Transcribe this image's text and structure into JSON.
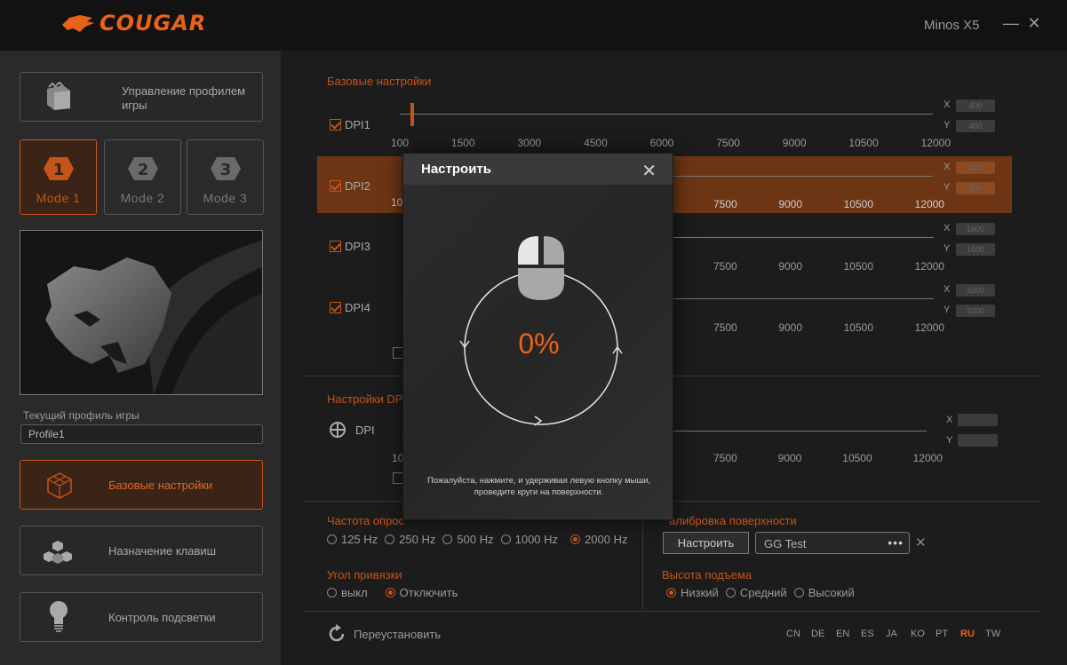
{
  "app": {
    "brand": "COUGAR",
    "device": "Minos X5",
    "minimize": "—",
    "close": "✕"
  },
  "sidebar": {
    "profile_manager": "Управление профилем игры",
    "modes": [
      {
        "label": "Mode 1",
        "number": "1"
      },
      {
        "label": "Mode 2",
        "number": "2"
      },
      {
        "label": "Mode 3",
        "number": "3"
      }
    ],
    "current_profile_caption": "Текущий профиль игры",
    "current_profile_value": "Profile1",
    "nav": [
      {
        "label": "Базовые настройки"
      },
      {
        "label": "Назначение клавиш"
      },
      {
        "label": "Контроль подсветки"
      }
    ]
  },
  "basic": {
    "title": "Базовые настройки",
    "ticks": [
      "100",
      "1500",
      "3000",
      "4500",
      "6000",
      "7500",
      "9000",
      "10500",
      "12000"
    ],
    "ticks_partial": [
      "10",
      "7500",
      "9000",
      "10500",
      "12000"
    ],
    "dpi_rows": [
      {
        "label": "DPI1",
        "x": "400",
        "y": "400"
      },
      {
        "label": "DPI2",
        "x": "800",
        "y": "800"
      },
      {
        "label": "DPI3",
        "x": "1600",
        "y": "1600"
      },
      {
        "label": "DPI4",
        "x": "3200",
        "y": "3200"
      }
    ],
    "x_label": "X",
    "y_label": "Y"
  },
  "dpi_settings": {
    "title": "Настройки DP",
    "label": "DPI",
    "ticks": [
      "10",
      "7500",
      "9000",
      "10500",
      "12000"
    ]
  },
  "polling": {
    "title": "Частота опрос",
    "options": [
      "125 Hz",
      "250 Hz",
      "500 Hz",
      "1000 Hz",
      "2000 Hz"
    ],
    "selected": "2000 Hz"
  },
  "snap": {
    "title": "Угол привязки",
    "options": [
      "выкл",
      "Отключить"
    ],
    "selected": "Отключить"
  },
  "surface": {
    "title": "алибровка поверхности",
    "button": "Настроить",
    "value": "GG Test",
    "dots": "•••",
    "clear": "✕"
  },
  "lift": {
    "title": "Высота подъема",
    "options": [
      "Низкий",
      "Средний",
      "Высокий"
    ],
    "selected": "Низкий"
  },
  "footer": {
    "reset": "Переустановить",
    "languages": [
      "CN",
      "DE",
      "EN",
      "ES",
      "JA",
      "KO",
      "PT",
      "RU",
      "TW"
    ],
    "active_language": "RU"
  },
  "modal": {
    "title": "Настроить",
    "close": "✕",
    "progress": "0%",
    "instruction": "Пожалуйста, нажмите, и удерживая левую кнопку мыши, проведите круги на поверхности."
  },
  "colors": {
    "accent": "#e8621a",
    "highlight_row": "#6e3514"
  }
}
